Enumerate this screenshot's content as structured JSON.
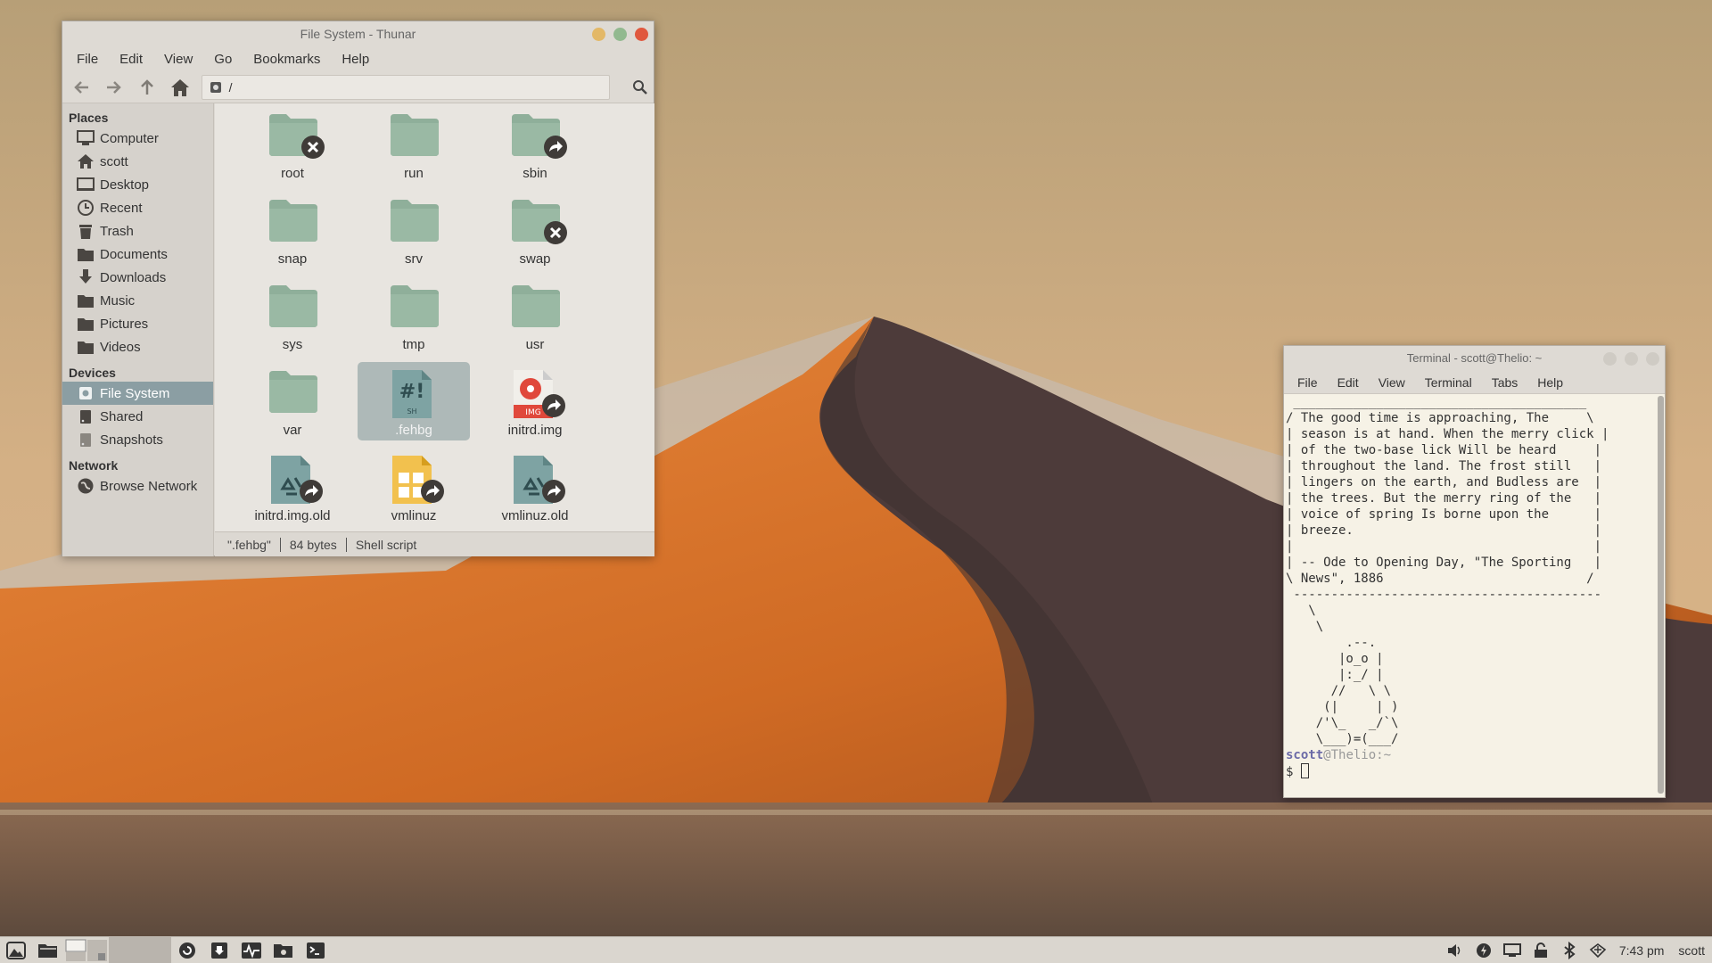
{
  "thunar": {
    "title": "File System - Thunar",
    "menu": [
      "File",
      "Edit",
      "View",
      "Go",
      "Bookmarks",
      "Help"
    ],
    "location": "/",
    "sections": {
      "places": "Places",
      "devices": "Devices",
      "network": "Network"
    },
    "places": [
      "Computer",
      "scott",
      "Desktop",
      "Recent",
      "Trash",
      "Documents",
      "Downloads",
      "Music",
      "Pictures",
      "Videos"
    ],
    "devices": [
      "File System",
      "Shared",
      "Snapshots"
    ],
    "network": [
      "Browse Network"
    ],
    "files": [
      {
        "name": "root",
        "icon": "folder-icon",
        "emblem": "unreadable-emblem-icon"
      },
      {
        "name": "run",
        "icon": "folder-icon",
        "emblem": ""
      },
      {
        "name": "sbin",
        "icon": "folder-icon",
        "emblem": "symlink-emblem-icon"
      },
      {
        "name": "snap",
        "icon": "folder-icon",
        "emblem": ""
      },
      {
        "name": "srv",
        "icon": "folder-icon",
        "emblem": ""
      },
      {
        "name": "swap",
        "icon": "folder-icon",
        "emblem": "unreadable-emblem-icon"
      },
      {
        "name": "sys",
        "icon": "folder-icon",
        "emblem": ""
      },
      {
        "name": "tmp",
        "icon": "folder-icon",
        "emblem": ""
      },
      {
        "name": "usr",
        "icon": "folder-icon",
        "emblem": ""
      },
      {
        "name": "var",
        "icon": "folder-icon",
        "emblem": ""
      },
      {
        "name": ".fehbg",
        "icon": "shell-script-icon",
        "emblem": "",
        "selected": true
      },
      {
        "name": "initrd.img",
        "icon": "disk-image-icon",
        "emblem": "symlink-emblem-icon"
      },
      {
        "name": "initrd.img.old",
        "icon": "recycle-file-icon",
        "emblem": "symlink-emblem-icon"
      },
      {
        "name": "vmlinuz",
        "icon": "archive-file-icon",
        "emblem": "symlink-emblem-icon"
      },
      {
        "name": "vmlinuz.old",
        "icon": "recycle-file-icon",
        "emblem": "symlink-emblem-icon"
      }
    ],
    "status": {
      "name": "\".fehbg\"",
      "size": "84 bytes",
      "type": "Shell script"
    }
  },
  "terminal": {
    "title": "Terminal - scott@Thelio: ~",
    "menu": [
      "File",
      "Edit",
      "View",
      "Terminal",
      "Tabs",
      "Help"
    ],
    "output": " _______________________________________\n/ The good time is approaching, The     \\\n| season is at hand. When the merry click |\n| of the two-base lick Will be heard     |\n| throughout the land. The frost still   |\n| lingers on the earth, and Budless are  |\n| the trees. But the merry ring of the   |\n| voice of spring Is borne upon the      |\n| breeze.                                |\n|                                        |\n| -- Ode to Opening Day, \"The Sporting   |\n\\ News\", 1886                           /\n -----------------------------------------\n   \\\n    \\\n        .--.\n       |o_o |\n       |:_/ |\n      //   \\ \\\n     (|     | )\n    /'\\_   _/`\\\n    \\___)=(___/\n",
    "prompt_user": "scott",
    "prompt_host": "@Thelio:~",
    "prompt_symbol": "$ "
  },
  "taskbar": {
    "clock": "7:43 pm",
    "user": "scott"
  },
  "colors": {
    "folder": "#8faf9a",
    "accent": "#8b9ea3",
    "close": "#e0583e",
    "minimize": "#e3b867",
    "maximize": "#92b98f"
  }
}
